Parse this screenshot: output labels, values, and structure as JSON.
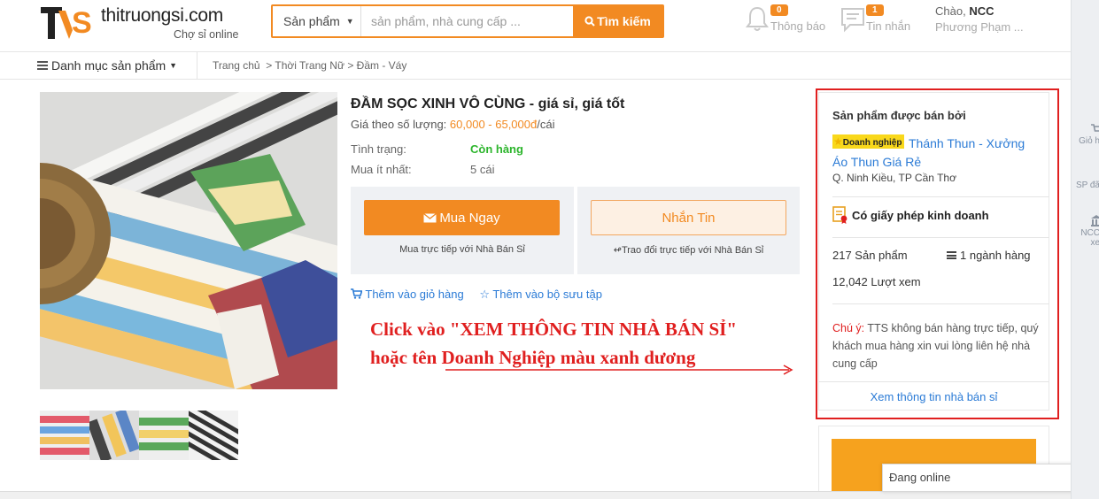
{
  "header": {
    "logo_text": "thitruongsi.com",
    "logo_sub": "Chợ sỉ online",
    "search": {
      "category": "Sản phẩm",
      "placeholder": "sản phẩm, nhà cung cấp ...",
      "button": "Tìm kiếm"
    },
    "notifications": {
      "count": "0",
      "label": "Thông báo"
    },
    "messages": {
      "count": "1",
      "label": "Tin nhắn"
    },
    "user": {
      "greeting": "Chào,",
      "name": "NCC",
      "username": "Phương Phạm ..."
    }
  },
  "nav": {
    "categories": "Danh mục sản phẩm",
    "breadcrumb": [
      "Trang chủ",
      "Thời Trang Nữ",
      "Đầm - Váy"
    ]
  },
  "product": {
    "title": "ĐẦM SỌC XINH VÔ CÙNG - giá sỉ, giá tốt",
    "price_label": "Giá theo số lượng:",
    "price": "60,000 - 65,000đ",
    "price_unit": "/cái",
    "status_label": "Tình trạng:",
    "status_value": "Còn hàng",
    "min_label": "Mua ít nhất:",
    "min_value": "5 cái",
    "buy_button": "Mua Ngay",
    "buy_note": "Mua trực tiếp với Nhà Bán Sỉ",
    "message_button": "Nhắn Tin",
    "message_note": "Trao đổi trực tiếp với Nhà Bán Sỉ",
    "add_cart": "Thêm vào giỏ hàng",
    "add_collection": "Thêm vào bộ sưu tập"
  },
  "annotation": {
    "line1": "Click vào \"XEM THÔNG TIN NHÀ BÁN SỈ\"",
    "line2": "hoặc tên Doanh Nghiệp màu xanh dương"
  },
  "seller": {
    "heading": "Sản phẩm được bán bởi",
    "badge": "Doanh nghiệp",
    "shop_name": "Thánh Thun - Xưởng Áo Thun Giá Rẻ",
    "location": "Q. Ninh Kiều, TP Cần Thơ",
    "license": "Có giấy phép kinh doanh",
    "products": "217 Sản phẩm",
    "industries": "1 ngành hàng",
    "views": "12,042 Lượt xem",
    "note_label": "Chú ý:",
    "note_text": "TTS không bán hàng trực tiếp, quý khách mua hàng xin vui lòng liên hệ nhà cung cấp",
    "view_link": "Xem thông tin nhà bán sỉ"
  },
  "online": "Đang online",
  "sidebar": [
    "Giỏ h",
    "SP đã",
    "NCC",
    "xe"
  ],
  "colors": {
    "brand": "#f28a22",
    "link": "#2b7bd6",
    "annotation": "#e01f1f",
    "in_stock": "#2cb52c"
  }
}
